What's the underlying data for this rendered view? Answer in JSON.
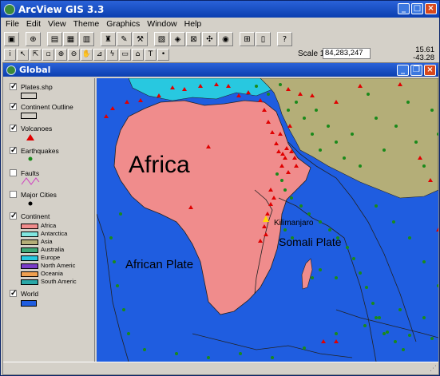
{
  "window": {
    "title": "ArcView GIS 3.3"
  },
  "menu": [
    "File",
    "Edit",
    "View",
    "Theme",
    "Graphics",
    "Window",
    "Help"
  ],
  "scale": {
    "label": "Scale 1:",
    "value": "84,283,247"
  },
  "coords": {
    "x": "15.61",
    "y": "-43.28"
  },
  "view": {
    "title": "Global"
  },
  "themes": {
    "plates": "Plates.shp",
    "continent_outline": "Continent Outline",
    "volcanoes": "Volcanoes",
    "earthquakes": "Earthquakes",
    "faults": "Faults",
    "major_cities": "Major Cities",
    "continent": "Continent",
    "world": "World"
  },
  "continent_legend": [
    {
      "label": "Africa",
      "color": "#f08c8c"
    },
    {
      "label": "Antarctica",
      "color": "#80e6e0"
    },
    {
      "label": "Asia",
      "color": "#b4ae78"
    },
    {
      "label": "Australia",
      "color": "#40a878"
    },
    {
      "label": "Europe",
      "color": "#28c8e0"
    },
    {
      "label": "North Americ",
      "color": "#7a3cc8"
    },
    {
      "label": "Oceania",
      "color": "#f0a050"
    },
    {
      "label": "South Americ",
      "color": "#2aa8a8"
    }
  ],
  "map_labels": {
    "africa": "Africa",
    "african_plate": "African Plate",
    "somali_plate": "Somali Plate",
    "kilimanjaro": "Kilimanjaro"
  },
  "colors": {
    "ocean": "#1f5de0",
    "africa": "#f08c8c",
    "asia": "#b4ae78",
    "europe": "#28c8e0",
    "volcano": "#e00000",
    "earthquake": "#1a8a1a"
  }
}
